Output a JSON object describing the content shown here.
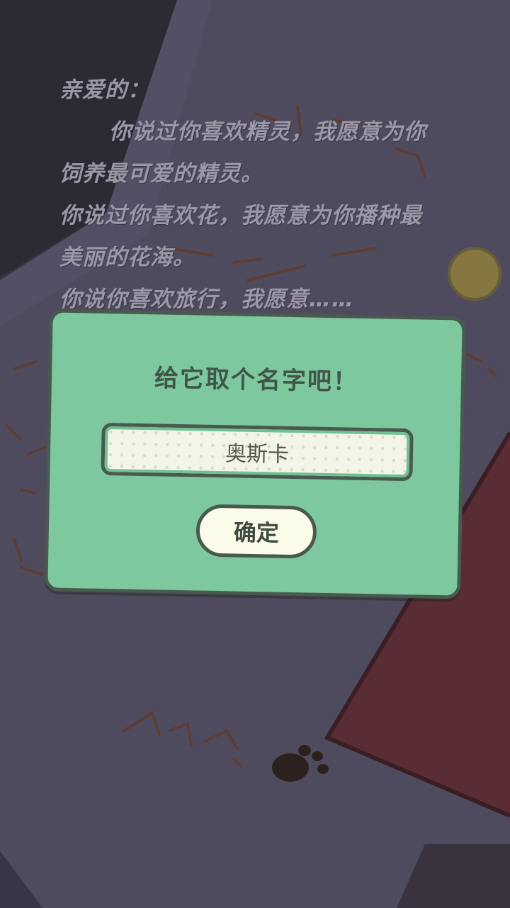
{
  "letter": {
    "greeting": "亲爱的：",
    "lines": [
      "你说过你喜欢精灵，我愿意为你",
      "饲养最可爱的精灵。",
      "你说过你喜欢花，我愿意为你播种最",
      "美丽的花海。",
      "你说你喜欢旅行，我愿意……"
    ]
  },
  "dialog": {
    "title": "给它取个名字吧！",
    "name_value": "奥斯卡",
    "confirm_label": "确定"
  },
  "colors": {
    "dialog_bg": "#7ec8a0",
    "dialog_border": "#485a4e",
    "button_bg": "#fbfbea",
    "envelope": "#5a2c34",
    "paper": "#4e4a5e"
  }
}
